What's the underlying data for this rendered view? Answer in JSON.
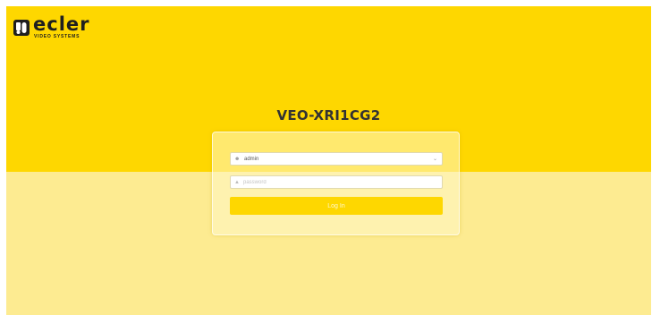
{
  "brand": {
    "name": "ecler",
    "subtitle": "VIDEO SYSTEMS",
    "logo_icon": "ecler-logo-icon"
  },
  "device": {
    "title": "VEO-XRI1CG2"
  },
  "login": {
    "user": {
      "icon": "user-icon",
      "value": "admin",
      "dropdown_icon": "chevron-down-icon"
    },
    "password": {
      "icon": "lock-icon",
      "placeholder": "password"
    },
    "submit_label": "Log In"
  },
  "colors": {
    "top_band": "#fed700",
    "bottom_band": "#fdeb91",
    "button": "#fed700"
  }
}
